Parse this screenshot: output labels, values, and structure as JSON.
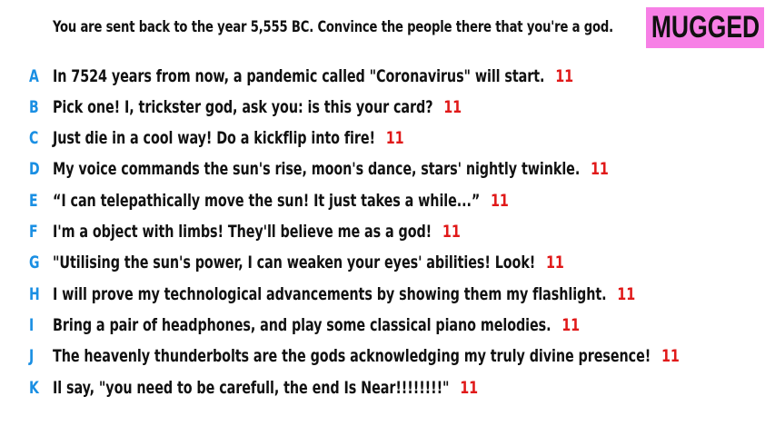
{
  "prompt": "You are sent back to the year 5,555 BC. Convince the people there that you're a god.",
  "badge": {
    "label": "MUGGED",
    "color": "#f780e6"
  },
  "colors": {
    "letter": "#1a8fe3",
    "score": "#e01919"
  },
  "answers": [
    {
      "letter": "A",
      "text": "In 7524 years from now, a pandemic called \"Coronavirus\" will start.",
      "score": "11"
    },
    {
      "letter": "B",
      "text": "Pick one! I, trickster god, ask you: is this your card?",
      "score": "11"
    },
    {
      "letter": "C",
      "text": "Just die in a cool way! Do a kickflip into fire!",
      "score": "11"
    },
    {
      "letter": "D",
      "text": "My voice commands the sun's rise, moon's dance, stars' nightly twinkle.",
      "score": "11"
    },
    {
      "letter": "E",
      "text": "“I can telepathically move the sun! It just takes a while...”",
      "score": "11"
    },
    {
      "letter": "F",
      "text": "I'm a object with limbs! They'll believe me as a god!",
      "score": "11"
    },
    {
      "letter": "G",
      "text": "\"Utilising the sun's power, I can weaken your eyes' abilities! Look!",
      "score": "11"
    },
    {
      "letter": "H",
      "text": "I will prove my technological advancements by showing them my flashlight.",
      "score": "11"
    },
    {
      "letter": "I",
      "text": "Bring a pair of headphones, and play some classical piano melodies.",
      "score": "11"
    },
    {
      "letter": "J",
      "text": "The heavenly thunderbolts are the gods acknowledging my truly divine presence!",
      "score": "11"
    },
    {
      "letter": "K",
      "text": "Il say, \"you need to be carefull, the end Is Near!!!!!!!!\"",
      "score": "11"
    }
  ]
}
